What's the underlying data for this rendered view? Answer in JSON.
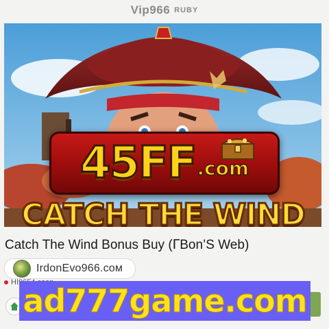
{
  "header": {
    "site_name": "Vip966",
    "site_sub": "RUBY"
  },
  "hero": {
    "promo_main": "45FF",
    "promo_suffix": ".com",
    "art_title": "CATCH THE WIND"
  },
  "game": {
    "title": "Catch The Wind Bonus Buy (ᒥBon’S Web)",
    "domain": "IrdonEvo966.coᴍ",
    "source": "HI9654 coon"
  },
  "ad": {
    "text": "ad777game.com"
  },
  "colors": {
    "ad_background": "#6a5ff4",
    "ad_text": "#ffe21c",
    "promo_red": "#c81a17",
    "promo_gold": "#ffd21a",
    "button_green": "#7fa653"
  }
}
